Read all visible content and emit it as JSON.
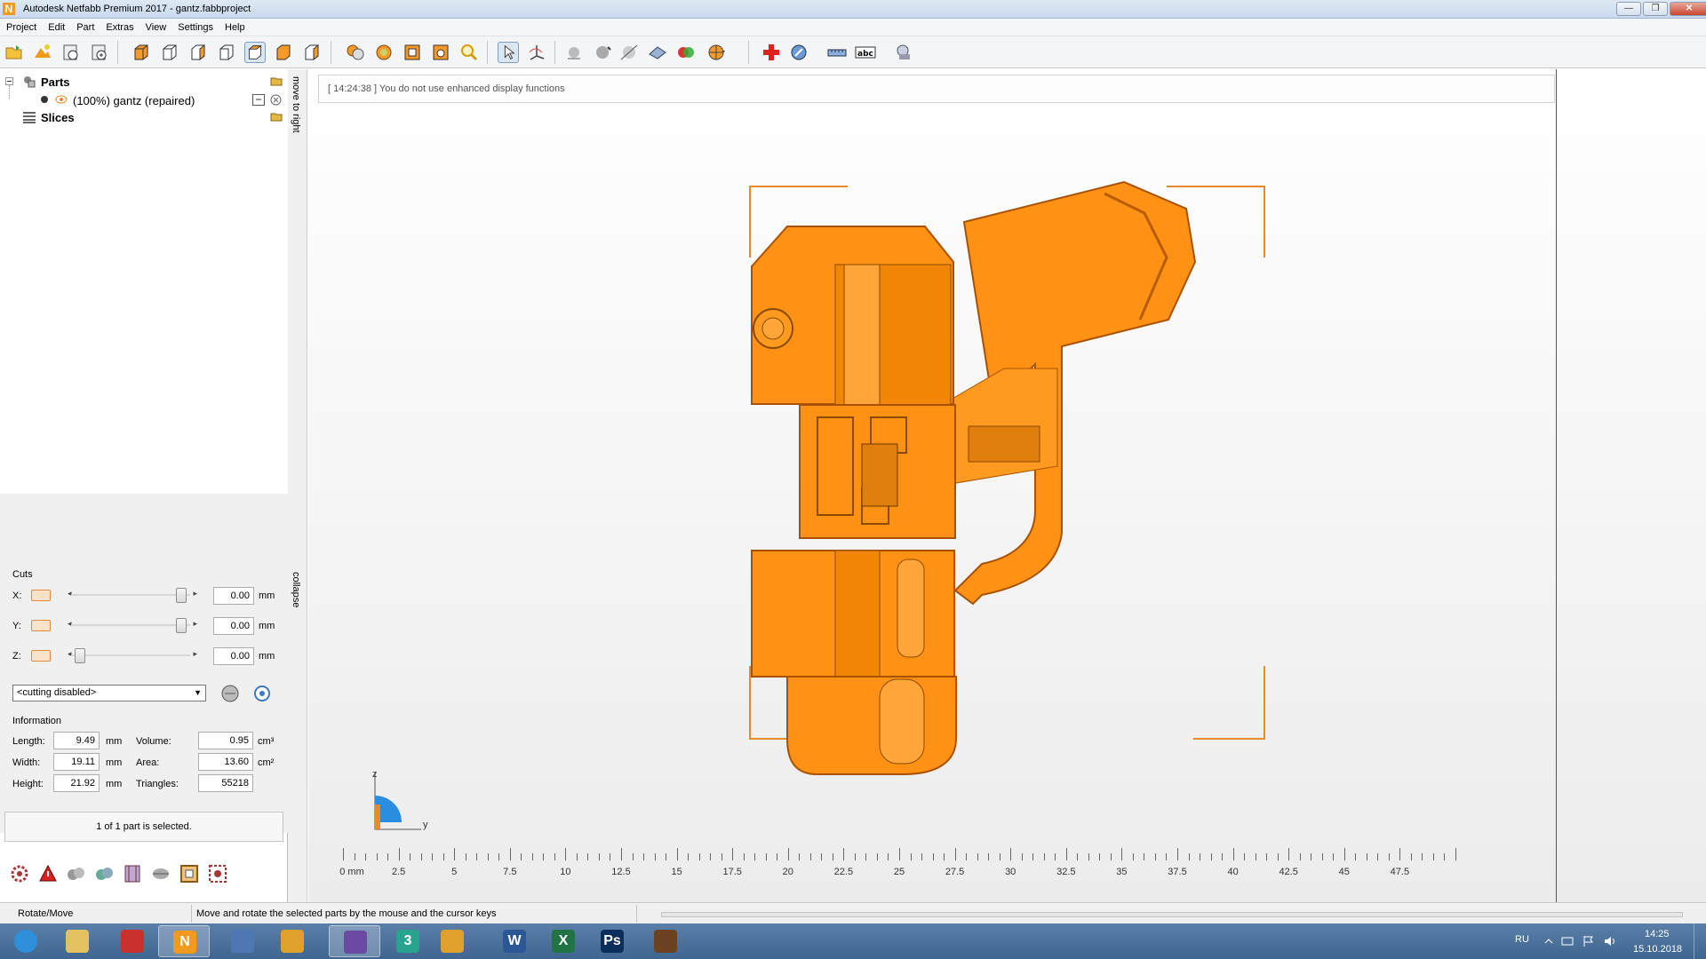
{
  "window": {
    "title": "Autodesk Netfabb Premium 2017 - gantz.fabbproject",
    "app_icon_letter": "N",
    "minimize": "—",
    "maximize": "❐",
    "close": "✕"
  },
  "menu": [
    "Project",
    "Edit",
    "Part",
    "Extras",
    "View",
    "Settings",
    "Help"
  ],
  "toolbar_icons": [
    "open-project-icon",
    "import-part-icon",
    "add-part-icon",
    "add-part-2-icon",
    "view-front-icon",
    "view-back-icon",
    "view-left-icon",
    "view-right-icon",
    "view-top-icon",
    "view-bottom-icon",
    "view-iso-icon",
    "zoom-selection-icon",
    "zoom-all-icon",
    "zoom-part-icon",
    "zoom-fit-icon",
    "zoom-magnifier-icon",
    "select-arrow-icon",
    "rotate-tool-icon",
    "display-mode-icon",
    "shading-icon",
    "measure-points-icon",
    "mesh-icon",
    "color-mode-icon",
    "wheel-menu-icon",
    "repair-cross-icon",
    "analysis-icon",
    "ruler-icon",
    "label-abc-icon",
    "measurement-icon"
  ],
  "tree": {
    "parts_label": "Parts",
    "part_name": "(100%) gantz (repaired)",
    "slices_label": "Slices"
  },
  "side_tabs": {
    "move_right": "move to right",
    "collapse": "collapse"
  },
  "cuts": {
    "title": "Cuts",
    "axes": [
      {
        "label": "X:",
        "value": "0.00",
        "unit": "mm",
        "slider": 1.0
      },
      {
        "label": "Y:",
        "value": "0.00",
        "unit": "mm",
        "slider": 1.0
      },
      {
        "label": "Z:",
        "value": "0.00",
        "unit": "mm",
        "slider": 0.0
      }
    ],
    "mode": "<cutting disabled>"
  },
  "information": {
    "title": "Information",
    "length_label": "Length:",
    "length": "9.49",
    "length_unit": "mm",
    "width_label": "Width:",
    "width": "19.11",
    "width_unit": "mm",
    "height_label": "Height:",
    "height": "21.92",
    "height_unit": "mm",
    "volume_label": "Volume:",
    "volume": "0.95",
    "volume_unit": "cm³",
    "area_label": "Area:",
    "area": "13.60",
    "area_unit": "cm²",
    "triangles_label": "Triangles:",
    "triangles": "55218"
  },
  "selection_status": "1 of 1 part is selected.",
  "bottom_icons": [
    "settings-gear-icon",
    "warning-icon",
    "repair-icon",
    "refresh-icon",
    "slice-icon",
    "sphere-icon",
    "frame-icon",
    "grid-gear-icon"
  ],
  "viewport": {
    "log": "[ 14:24:38 ] You do not use enhanced display functions",
    "axis_z": "z",
    "axis_y": "y",
    "ruler_labels": [
      "0 mm",
      "2.5",
      "5",
      "7.5",
      "10",
      "12.5",
      "15",
      "17.5",
      "20",
      "22.5",
      "25",
      "27.5",
      "30",
      "32.5",
      "35",
      "37.5",
      "40",
      "42.5",
      "45",
      "47.5"
    ]
  },
  "statusbar": {
    "mode": "Rotate/Move",
    "hint": "Move and rotate the selected parts by the mouse and the cursor keys"
  },
  "taskbar": {
    "apps": [
      {
        "name": "start-orb-icon",
        "letter": ""
      },
      {
        "name": "explorer-folder-icon",
        "letter": ""
      },
      {
        "name": "screenshot-app-icon",
        "letter": ""
      },
      {
        "name": "netfabb-taskbar-icon",
        "letter": "N"
      },
      {
        "name": "browser-app-icon",
        "letter": ""
      },
      {
        "name": "chrome-icon",
        "letter": ""
      },
      {
        "name": "books-app-icon",
        "letter": ""
      },
      {
        "name": "3dsmax-icon",
        "letter": "3"
      },
      {
        "name": "chrome-2-icon",
        "letter": ""
      },
      {
        "name": "word-icon",
        "letter": "W"
      },
      {
        "name": "excel-icon",
        "letter": "X"
      },
      {
        "name": "photoshop-icon",
        "letter": "Ps"
      },
      {
        "name": "game-app-icon",
        "letter": ""
      }
    ],
    "lang": "RU",
    "time": "14:25",
    "date": "15.10.2018"
  },
  "colors": {
    "model_orange": "#ff9214",
    "model_dark": "#b65d00",
    "bbox_orange": "#e88a2a",
    "axis_blue": "#2b8de0"
  }
}
